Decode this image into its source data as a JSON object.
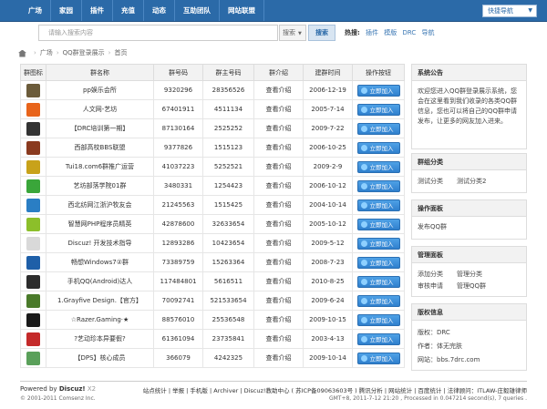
{
  "nav": {
    "items": [
      "广场",
      "家园",
      "插件",
      "充值",
      "动态",
      "互助团队",
      "网站联盟"
    ],
    "quick_nav": "快捷导航"
  },
  "search": {
    "placeholder": "请输入搜索内容",
    "type": "搜索",
    "button": "搜索",
    "hot_label": "热搜:",
    "hot_terms": [
      "插件",
      "模版",
      "DRC",
      "导航"
    ]
  },
  "breadcrumb": [
    "广场",
    "QQ群登录展示",
    "首页"
  ],
  "table": {
    "headers": [
      "群图标",
      "群名称",
      "群号码",
      "群主号码",
      "群介绍",
      "建群时间",
      "操作按钮"
    ],
    "view_label": "查看介绍",
    "join_label": "立即加入",
    "rows": [
      {
        "name": "pp娱乐会所",
        "group": "9320296",
        "owner": "28356526",
        "date": "2006-12-19",
        "icon_color": "#6b5b3a"
      },
      {
        "name": "人文网-艺坊",
        "group": "67401911",
        "owner": "4511134",
        "date": "2005-7-14",
        "icon_color": "#e8641b"
      },
      {
        "name": "【DRC培训第一期】",
        "group": "87130164",
        "owner": "2525252",
        "date": "2009-7-22",
        "icon_color": "#333333"
      },
      {
        "name": "西部高校BBS联盟",
        "group": "9377826",
        "owner": "1515123",
        "date": "2006-10-25",
        "icon_color": "#8a3a1f"
      },
      {
        "name": "Tui18.com6群推广运营",
        "group": "41037223",
        "owner": "5252521",
        "date": "2009-2-9",
        "icon_color": "#c8a21a"
      },
      {
        "name": "艺坊部落学院01群",
        "group": "3480331",
        "owner": "1254423",
        "date": "2006-10-12",
        "icon_color": "#3aa63a"
      },
      {
        "name": "西北纺网江浙沪牧友会",
        "group": "21245563",
        "owner": "1515425",
        "date": "2004-10-14",
        "icon_color": "#2a7ec4"
      },
      {
        "name": "智慧网PHP程序员精英",
        "group": "42878600",
        "owner": "32633654",
        "date": "2005-10-12",
        "icon_color": "#8cbf2a"
      },
      {
        "name": "Discuz! 开发技术指导",
        "group": "12893286",
        "owner": "10423654",
        "date": "2009-5-12",
        "icon_color": "#d9d9d9"
      },
      {
        "name": "畅想Windows7②群",
        "group": "73389759",
        "owner": "15263364",
        "date": "2008-7-23",
        "icon_color": "#1e5fa8"
      },
      {
        "name": "手机QQ(Android)达人",
        "group": "117484801",
        "owner": "5616511",
        "date": "2010-8-25",
        "icon_color": "#2c2c2c"
      },
      {
        "name": "1.Grayfive Design.【官方】",
        "group": "70092741",
        "owner": "521533654",
        "date": "2009-6-24",
        "icon_color": "#4a7a2a"
      },
      {
        "name": "☆Razer.Gaming·★",
        "group": "88576010",
        "owner": "25536548",
        "date": "2009-10-15",
        "icon_color": "#1a1a1a"
      },
      {
        "name": "?艺动珍本异要假?",
        "group": "61361094",
        "owner": "23735841",
        "date": "2003-4-13",
        "icon_color": "#c42a2a"
      },
      {
        "name": "【DPS】核心成员",
        "group": "366079",
        "owner": "4242325",
        "date": "2009-10-14",
        "icon_color": "#5aa05a"
      }
    ]
  },
  "sidebar": {
    "announce_title": "系统公告",
    "announce_text": "欢迎您进入QQ群登录展示系统，您会在这里看到我们收录的各类QQ群信息，您也可以将自己的QQ群申请发布，让更多的网友加入进来。",
    "category_title": "群组分类",
    "categories": [
      "测试分类",
      "测试分类2"
    ],
    "manage_title": "操作面板",
    "manage_link": "发布QQ群",
    "admin_title": "管理面板",
    "admin_links": [
      "添加分类",
      "管理分类",
      "审核申请",
      "管理QQ群"
    ],
    "copyright_title": "版权信息",
    "copyright_lines": [
      "版权：DRC",
      "作者：体无完肤",
      "网站：bbs.7drc.com"
    ]
  },
  "footer": {
    "powered": "Powered by",
    "brand": "Discuz!",
    "version": "X2",
    "copyright": "© 2001-2011 Comsenz Inc.",
    "links": "站点统计 | 举报 | 手机版 | Archiver | Discuz!教助中心 ( 苏ICP备09063603号 ) 腾讯分析 | 网站统计 | 百度统计 | 法律顾问：ITLAW-庄毅雄律师",
    "gmt": "GMT+8, 2011-7-12 21:20 , Processed in 0.047214 second(s), 7 queries ."
  }
}
